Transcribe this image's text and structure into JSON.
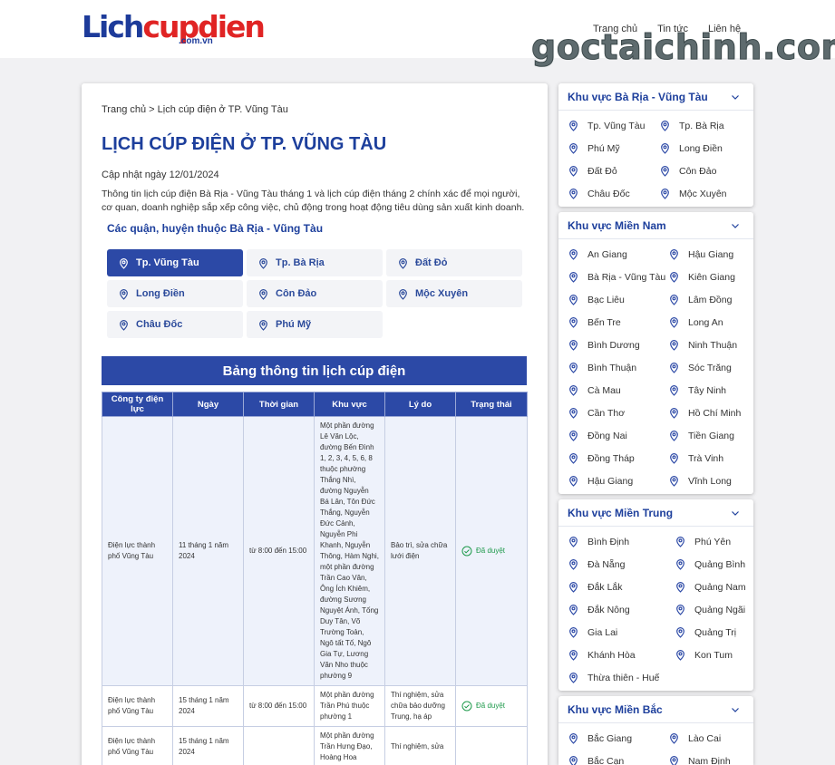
{
  "site": {
    "logo_main_a": "Lich",
    "logo_main_b": "cupdien",
    "logo_sub": ".com.vn",
    "nav": [
      "Trang chủ",
      "Tin tức",
      "Liên hệ"
    ],
    "watermark": "goctaichinh.com"
  },
  "main": {
    "breadcrumb": "Trang chủ > Lịch cúp điện ở TP. Vũng Tàu",
    "title": "LỊCH CÚP ĐIỆN Ở TP. VŨNG TÀU",
    "updated": "Cập nhật ngày 12/01/2024",
    "description": "Thông tin lịch cúp điện Bà Rịa - Vũng Tàu tháng 1 và lịch cúp điện tháng 2 chính xác để mọi người, cơ quan, doanh nghiệp sắp xếp công việc, chủ động trong hoạt động tiêu dùng sản xuất kinh doanh.",
    "districts_title": "Các quận, huyện thuộc Bà Rịa - Vũng Tàu",
    "districts": [
      "Tp. Vũng Tàu",
      "Tp. Bà Rịa",
      "Đất Đỏ",
      "Long Điền",
      "Côn Đảo",
      "Mộc Xuyên",
      "Châu Đốc",
      "Phú Mỹ"
    ],
    "active_district": "Tp. Vũng Tàu",
    "table_title": "Bảng thông tin lịch cúp điện",
    "table_headers": [
      "Công ty điện lực",
      "Ngày",
      "Thời gian",
      "Khu vực",
      "Lý do",
      "Trạng thái"
    ],
    "rows": [
      {
        "company": "Điện lực thành phố Vũng Tàu",
        "date": "11 tháng 1 năm 2024",
        "time": "từ 8:00 đến 15:00",
        "area": "Một phần đường Lê Văn Lộc, đường Bến Đình 1, 2, 3, 4, 5, 6, 8 thuộc phường Thắng Nhì, đường Nguyễn Bá Lân, Tôn Đức Thắng, Nguyễn Đức Cảnh, Nguyễn Phi Khanh, Nguyễn Thông, Hàm Nghi, một phần đường Trần Cao Vân, Ông Ích Khiêm, đường Sương Nguyệt Ánh, Tống Duy Tân, Võ Trường Toản, Ngô tất Tố, Ngô Gia Tự, Lương Văn Nho thuộc phường 9",
        "reason": "Bảo trì, sửa chữa lưới điện",
        "status": "Đã duyệt"
      },
      {
        "company": "Điện lực thành phố Vũng Tàu",
        "date": "15 tháng 1 năm 2024",
        "time": "từ 8:00 đến 15:00",
        "area": "Một phần đường Trần Phú thuộc phường 1",
        "reason": "Thí nghiệm, sửa chữa bảo dưỡng Trung, hạ áp",
        "status": "Đã duyệt"
      },
      {
        "company": "Điện lực thành phố Vũng Tàu",
        "date": "15 tháng 1 năm 2024",
        "time": "",
        "area": "Một phần đường Trần Hưng Đạo, Hoàng Hoa",
        "reason": "Thí nghiệm, sửa",
        "status": ""
      }
    ]
  },
  "sidebar": [
    {
      "title": "Khu vực Bà Rịa - Vũng Tàu",
      "items": [
        "Tp. Vũng Tàu",
        "Tp. Bà Rịa",
        "Phú Mỹ",
        "Long Điền",
        "Đất Đỏ",
        "Côn Đảo",
        "Châu Đốc",
        "Mộc Xuyên"
      ]
    },
    {
      "title": "Khu vực Miền Nam",
      "items": [
        "An Giang",
        "Hậu Giang",
        "Bà Rịa - Vũng Tàu",
        "Kiên Giang",
        "Bạc Liêu",
        "Lâm Đồng",
        "Bến Tre",
        "Long An",
        "Bình Dương",
        "Ninh Thuận",
        "Bình Thuận",
        "Sóc Trăng",
        "Cà Mau",
        "Tây Ninh",
        "Cần Thơ",
        "Hồ Chí Minh",
        "Đồng Nai",
        "Tiền Giang",
        "Đồng Tháp",
        "Trà Vinh",
        "Hậu Giang",
        "Vĩnh Long"
      ]
    },
    {
      "title": "Khu vực Miền Trung",
      "items": [
        "Bình Định",
        "Phú Yên",
        "Đà Nẵng",
        "Quảng Bình",
        "Đắk Lắk",
        "Quảng Nam",
        "Đắk Nông",
        "Quảng Ngãi",
        "Gia Lai",
        "Quảng Trị",
        "Khánh Hòa",
        "Kon Tum",
        "Thừa thiên - Huế"
      ]
    },
    {
      "title": "Khu vực Miền Bắc",
      "items": [
        "Bắc Giang",
        "Lào Cai",
        "Bắc Cạn",
        "Nam Định"
      ]
    }
  ],
  "colors": {
    "brand_blue": "#2c49a6",
    "title_blue": "#1d3f9c",
    "logo_red": "#e02424",
    "ok_green": "#1f9a4c"
  },
  "icons": {
    "district": "map-pin-icon",
    "status": "check-circle-icon",
    "panel_toggle": "chevron-down-icon"
  }
}
